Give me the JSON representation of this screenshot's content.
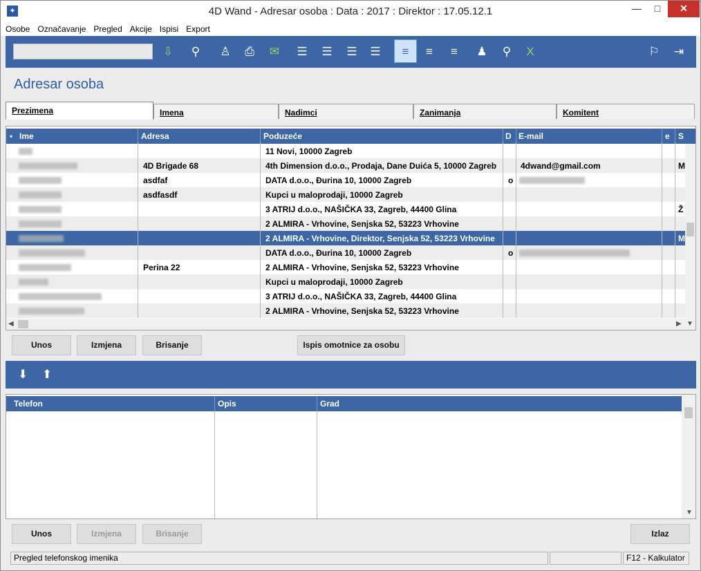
{
  "window": {
    "title": "4D Wand - Adresar osoba : Data : 2017 : Direktor : 17.05.12.1",
    "minimize": "—",
    "restore": "□",
    "close": "✕"
  },
  "menu": [
    "Osobe",
    "Označavanje",
    "Pregled",
    "Akcije",
    "Ispisi",
    "Export"
  ],
  "page": {
    "title": "Adresar osoba"
  },
  "tabs": [
    "Prezimena",
    "Imena",
    "Nadimci",
    "Zanimanja",
    "Komitent"
  ],
  "grid": {
    "columns": [
      "•",
      "Ime",
      "Adresa",
      "Poduzeće",
      "D",
      "E-mail",
      "e",
      "S"
    ],
    "rows": [
      {
        "adresa": "",
        "poduzece": "11 Novi, 10000 Zagreb",
        "d": "",
        "email": "",
        "s": ""
      },
      {
        "adresa": "4D Brigade 68",
        "poduzece": "4th Dimension d.o.o., Prodaja, Dane Duića 5, 10000 Zagreb",
        "d": "",
        "email": "4dwand@gmail.com",
        "s": "M"
      },
      {
        "adresa": "asdfaf",
        "poduzece": "DATA d.o.o., Đurina 10, 10000 Zagreb",
        "d": "o",
        "email": "",
        "s": ""
      },
      {
        "adresa": "asdfasdf",
        "poduzece": "Kupci u maloprodaji, 10000 Zagreb",
        "d": "",
        "email": "",
        "s": ""
      },
      {
        "adresa": "",
        "poduzece": "3 ATRIJ d.o.o., NAŠIČKA 33, Zagreb, 44400 Glina",
        "d": "",
        "email": "",
        "s": "Ž"
      },
      {
        "adresa": "",
        "poduzece": "2 ALMIRA - Vrhovine, Senjska 52, 53223 Vrhovine",
        "d": "",
        "email": "",
        "s": ""
      },
      {
        "adresa": "",
        "poduzece": "2 ALMIRA - Vrhovine, Direktor, Senjska 52, 53223 Vrhovine",
        "d": "",
        "email": "",
        "s": "M"
      },
      {
        "adresa": "",
        "poduzece": "DATA d.o.o., Đurina 10, 10000 Zagreb",
        "d": "o",
        "email": "",
        "s": ""
      },
      {
        "adresa": "Perina 22",
        "poduzece": "2 ALMIRA - Vrhovine, Senjska 52, 53223 Vrhovine",
        "d": "",
        "email": "",
        "s": ""
      },
      {
        "adresa": "",
        "poduzece": "Kupci u maloprodaji, 10000 Zagreb",
        "d": "",
        "email": "",
        "s": ""
      },
      {
        "adresa": "",
        "poduzece": "3 ATRIJ d.o.o., NAŠIČKA 33, Zagreb, 44400 Glina",
        "d": "",
        "email": "",
        "s": ""
      },
      {
        "adresa": "",
        "poduzece": "2 ALMIRA - Vrhovine, Senjska 52, 53223 Vrhovine",
        "d": "",
        "email": "",
        "s": ""
      }
    ],
    "selected_row": 6
  },
  "buttons": {
    "unos": "Unos",
    "izmjena": "Izmjena",
    "brisanje": "Brisanje",
    "ispis": "Ispis omotnice za osobu"
  },
  "grid2": {
    "columns": [
      "Telefon",
      "Opis",
      "Grad"
    ]
  },
  "buttons2": {
    "unos": "Unos",
    "izmjena": "Izmjena",
    "brisanje": "Brisanje",
    "izlaz": "Izlaz"
  },
  "status": {
    "left": "Pregled telefonskog imenika",
    "right": "F12 - Kalkulator"
  },
  "colors": {
    "accent": "#3c66a6",
    "title": "#2a5ea8"
  }
}
